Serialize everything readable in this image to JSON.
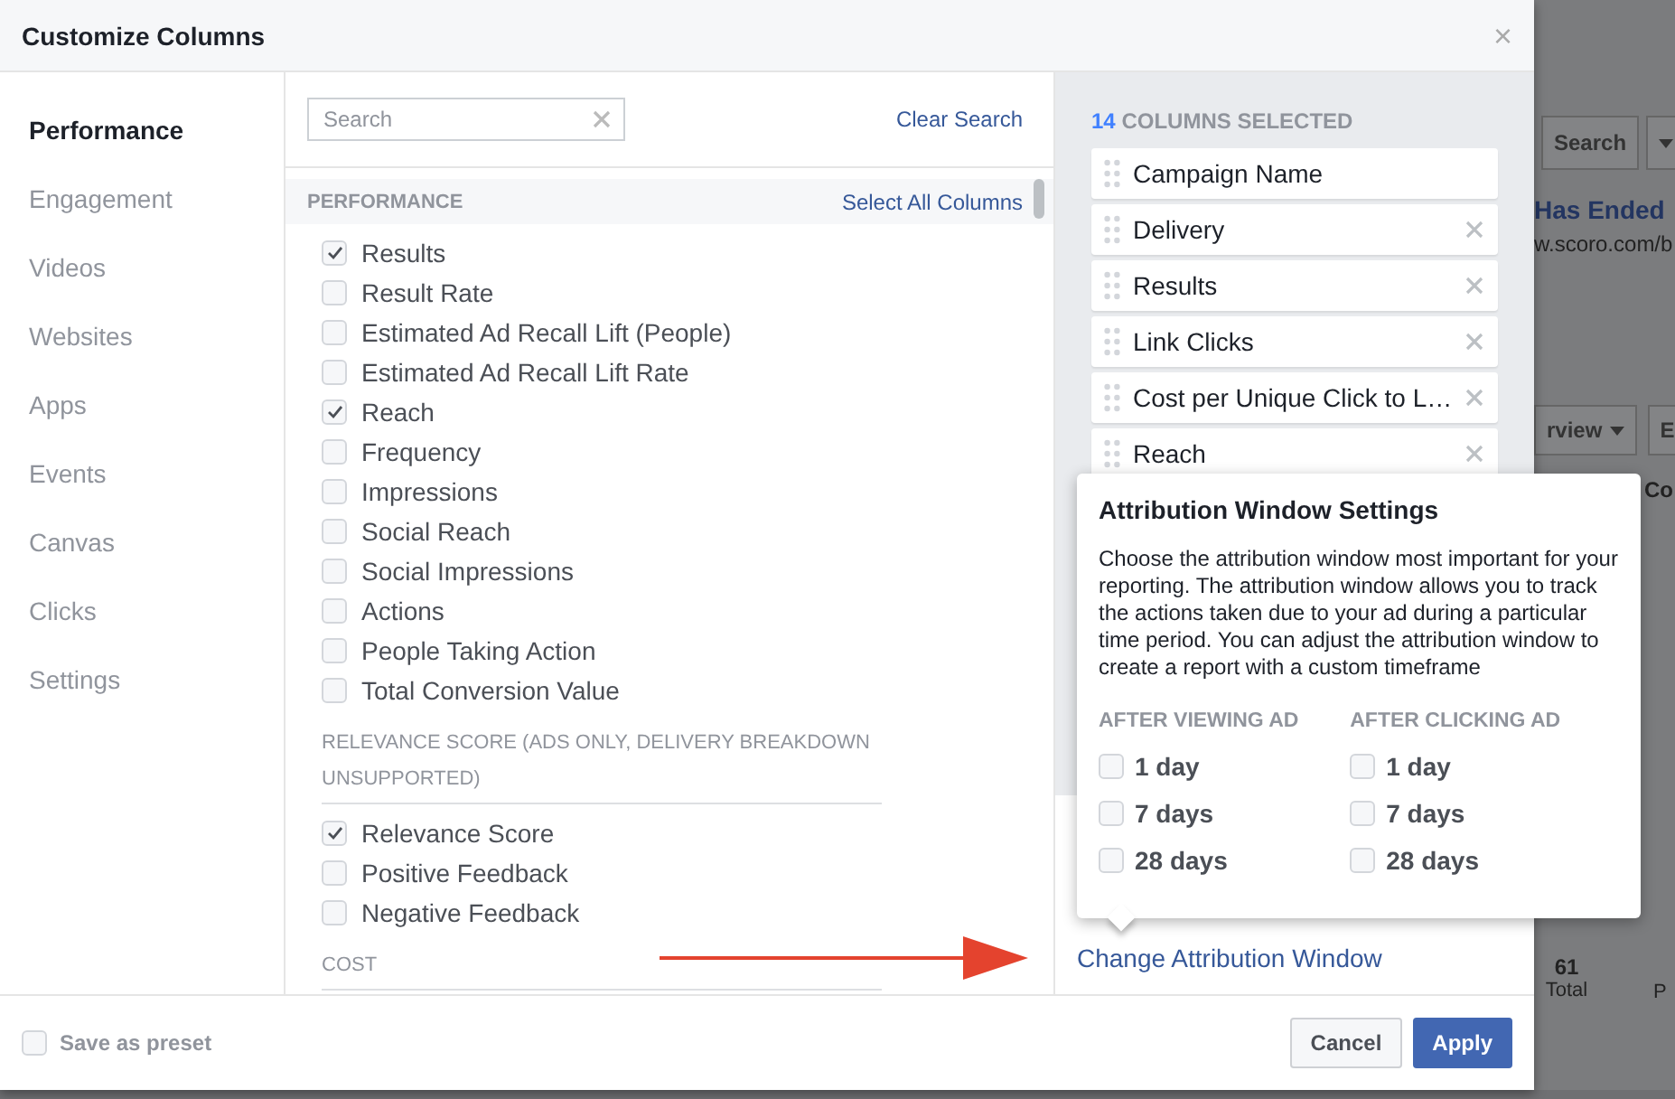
{
  "dialog": {
    "title": "Customize Columns",
    "close": "×"
  },
  "nav": [
    {
      "label": "Performance",
      "selected": true
    },
    {
      "label": "Engagement",
      "selected": false
    },
    {
      "label": "Videos",
      "selected": false
    },
    {
      "label": "Websites",
      "selected": false
    },
    {
      "label": "Apps",
      "selected": false
    },
    {
      "label": "Events",
      "selected": false
    },
    {
      "label": "Canvas",
      "selected": false
    },
    {
      "label": "Clicks",
      "selected": false
    },
    {
      "label": "Settings",
      "selected": false
    }
  ],
  "search": {
    "placeholder": "Search",
    "clear": "Clear Search"
  },
  "sections": [
    {
      "title": "PERFORMANCE",
      "kind": "band",
      "action": "Select All Columns",
      "items": [
        {
          "label": "Results",
          "checked": true
        },
        {
          "label": "Result Rate",
          "checked": false
        },
        {
          "label": "Estimated Ad Recall Lift (People)",
          "checked": false
        },
        {
          "label": "Estimated Ad Recall Lift Rate",
          "checked": false
        },
        {
          "label": "Reach",
          "checked": true
        },
        {
          "label": "Frequency",
          "checked": false
        },
        {
          "label": "Impressions",
          "checked": false
        },
        {
          "label": "Social Reach",
          "checked": false
        },
        {
          "label": "Social Impressions",
          "checked": false
        },
        {
          "label": "Actions",
          "checked": false
        },
        {
          "label": "People Taking Action",
          "checked": false
        },
        {
          "label": "Total Conversion Value",
          "checked": false
        }
      ]
    },
    {
      "title": "RELEVANCE SCORE (ADS ONLY, DELIVERY BREAKDOWN UNSUPPORTED)",
      "kind": "plain",
      "items": [
        {
          "label": "Relevance Score",
          "checked": true
        },
        {
          "label": "Positive Feedback",
          "checked": false
        },
        {
          "label": "Negative Feedback",
          "checked": false
        }
      ]
    },
    {
      "title": "COST",
      "kind": "plain"
    }
  ],
  "selected_columns": {
    "count": "14",
    "label": "COLUMNS SELECTED",
    "items": [
      {
        "label": "Campaign Name",
        "removable": false
      },
      {
        "label": "Delivery",
        "removable": true
      },
      {
        "label": "Results",
        "removable": true
      },
      {
        "label": "Link Clicks",
        "removable": true
      },
      {
        "label": "Cost per Unique Click to L…",
        "removable": true
      },
      {
        "label": "Reach",
        "removable": true
      }
    ]
  },
  "change_link": "Change Attribution Window",
  "popover": {
    "title": "Attribution Window Settings",
    "body": "Choose the attribution window most important for your reporting. The attribution window allows you to track the actions taken due to your ad during a particular time period. You can adjust the attribution window to create a report with a custom timeframe",
    "groups": [
      {
        "heading": "AFTER VIEWING AD",
        "options": [
          {
            "label": "1 day",
            "checked": false
          },
          {
            "label": "7 days",
            "checked": false
          },
          {
            "label": "28 days",
            "checked": false
          }
        ]
      },
      {
        "heading": "AFTER CLICKING AD",
        "options": [
          {
            "label": "1 day",
            "checked": false
          },
          {
            "label": "7 days",
            "checked": false
          },
          {
            "label": "28 days",
            "checked": false
          }
        ]
      }
    ]
  },
  "footer": {
    "preset": {
      "label": "Save as preset",
      "checked": false
    },
    "buttons": [
      {
        "label": "Cancel",
        "kind": "secondary"
      },
      {
        "label": "Apply",
        "kind": "primary"
      }
    ]
  },
  "background": {
    "search_button": "Search",
    "ad_title": "Has Ended",
    "ad_url": "w.scoro.com/b",
    "view_button": "rview",
    "button_2": "E",
    "column_header": "Co",
    "total_value": "61",
    "total_label": "Total",
    "column_3": "P"
  }
}
